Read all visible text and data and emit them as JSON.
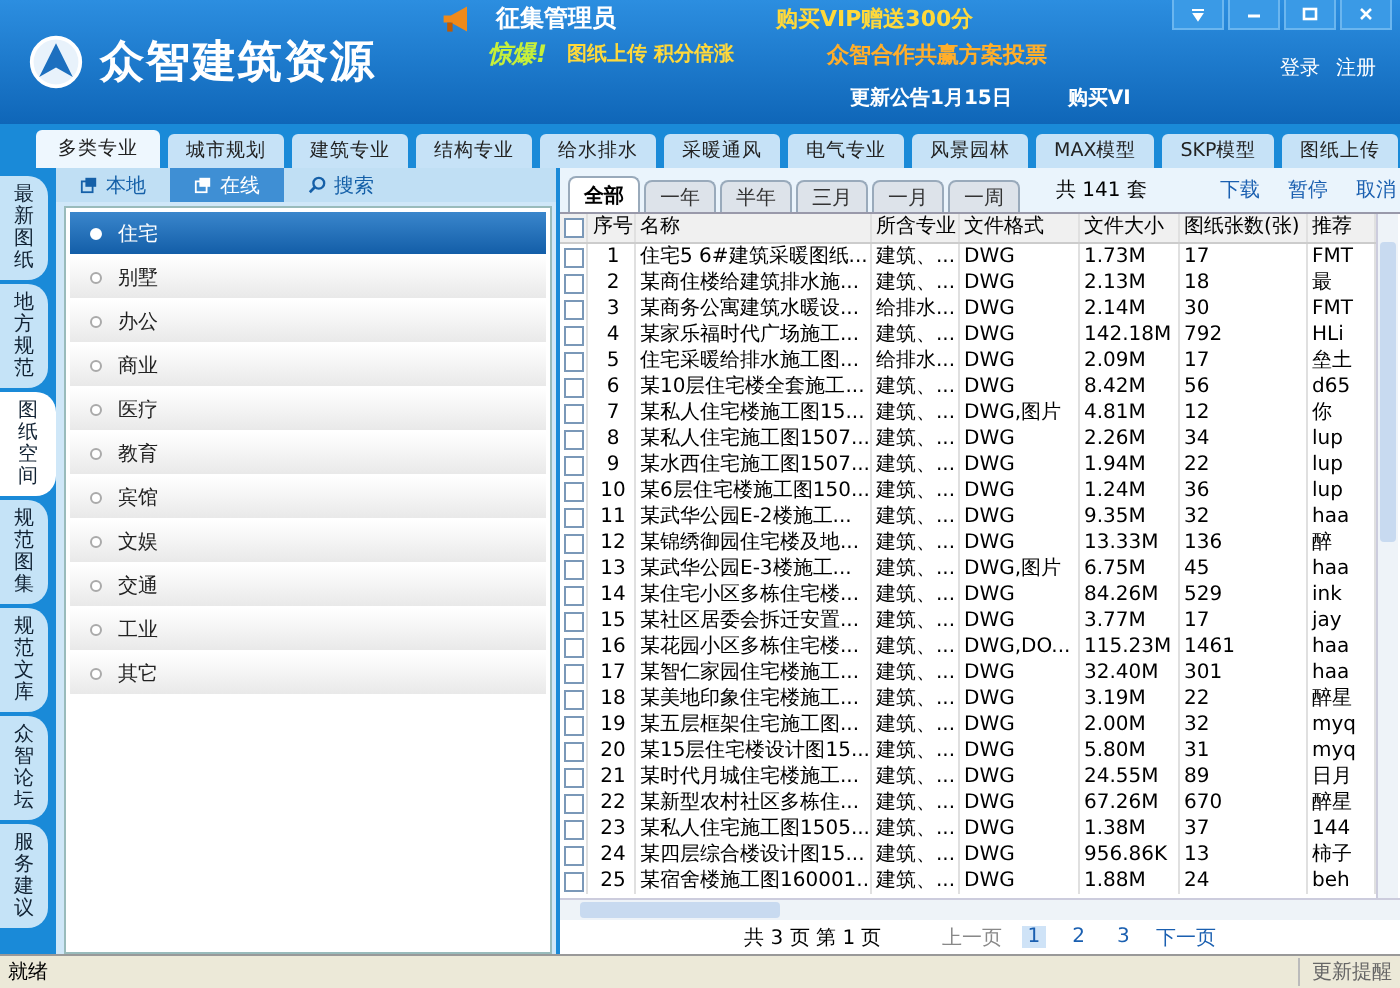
{
  "header": {
    "app_title": "众智建筑资源",
    "banner_title": "征集管理员",
    "banner_vip": "购买VIP赠送300分",
    "banner_alert": "惊爆!",
    "banner_upload": "图纸上传 积分倍涨",
    "banner_vote": "众智合作共赢方案投票",
    "notice": "更新公告1月15日",
    "buy": "购买VI",
    "login": "登录",
    "register": "注册"
  },
  "category_tabs": [
    {
      "label": "多类专业",
      "selected": true
    },
    {
      "label": "城市规划",
      "selected": false
    },
    {
      "label": "建筑专业",
      "selected": false
    },
    {
      "label": "结构专业",
      "selected": false
    },
    {
      "label": "给水排水",
      "selected": false
    },
    {
      "label": "采暖通风",
      "selected": false
    },
    {
      "label": "电气专业",
      "selected": false
    },
    {
      "label": "风景园林",
      "selected": false
    },
    {
      "label": "MAX模型",
      "selected": false
    },
    {
      "label": "SKP模型",
      "selected": false
    },
    {
      "label": "图纸上传",
      "selected": false
    }
  ],
  "side_tabs": [
    {
      "label": "最新图纸",
      "selected": false
    },
    {
      "label": "地方规范",
      "selected": false
    },
    {
      "label": "图纸空间",
      "selected": true
    },
    {
      "label": "规范图集",
      "selected": false
    },
    {
      "label": "规范文库",
      "selected": false
    },
    {
      "label": "众智论坛",
      "selected": false
    },
    {
      "label": "服务建议",
      "selected": false
    }
  ],
  "source_buttons": [
    {
      "label": "本地",
      "kind": "window",
      "selected": false
    },
    {
      "label": "在线",
      "kind": "window",
      "selected": true
    },
    {
      "label": "搜索",
      "kind": "search",
      "selected": false
    }
  ],
  "types": [
    {
      "label": "住宅",
      "selected": true
    },
    {
      "label": "别墅",
      "selected": false
    },
    {
      "label": "办公",
      "selected": false
    },
    {
      "label": "商业",
      "selected": false
    },
    {
      "label": "医疗",
      "selected": false
    },
    {
      "label": "教育",
      "selected": false
    },
    {
      "label": "宾馆",
      "selected": false
    },
    {
      "label": "文娱",
      "selected": false
    },
    {
      "label": "交通",
      "selected": false
    },
    {
      "label": "工业",
      "selected": false
    },
    {
      "label": "其它",
      "selected": false
    }
  ],
  "periods": [
    {
      "label": "全部",
      "selected": true
    },
    {
      "label": "一年",
      "selected": false
    },
    {
      "label": "半年",
      "selected": false
    },
    {
      "label": "三月",
      "selected": false
    },
    {
      "label": "一月",
      "selected": false
    },
    {
      "label": "一周",
      "selected": false
    }
  ],
  "total": "共 141 套",
  "actions": [
    "下载",
    "暂停",
    "取消"
  ],
  "table": {
    "select_all_checked": false,
    "columns": [
      "序号",
      "名称",
      "所含专业",
      "文件格式",
      "文件大小",
      "图纸张数(张)",
      "推荐"
    ],
    "rows": [
      {
        "checked": false,
        "cells": [
          "1",
          "住宅5 6#建筑采暖图纸...",
          "建筑、...",
          "DWG",
          "1.73M",
          "17",
          "FMT"
        ]
      },
      {
        "checked": false,
        "cells": [
          "2",
          "某商住楼给建筑排水施...",
          "建筑、...",
          "DWG",
          "2.13M",
          "18",
          "最"
        ]
      },
      {
        "checked": false,
        "cells": [
          "3",
          "某商务公寓建筑水暖设...",
          "给排水...",
          "DWG",
          "2.14M",
          "30",
          "FMT"
        ]
      },
      {
        "checked": false,
        "cells": [
          "4",
          "某家乐福时代广场施工...",
          "建筑、...",
          "DWG",
          "142.18M",
          "792",
          "HLi"
        ]
      },
      {
        "checked": false,
        "cells": [
          "5",
          "住宅采暖给排水施工图...",
          "给排水...",
          "DWG",
          "2.09M",
          "17",
          "垒土"
        ]
      },
      {
        "checked": false,
        "cells": [
          "6",
          "某10层住宅楼全套施工...",
          "建筑、...",
          "DWG",
          "8.42M",
          "56",
          "d65"
        ]
      },
      {
        "checked": false,
        "cells": [
          "7",
          "某私人住宅楼施工图15...",
          "建筑、...",
          "DWG,图片",
          "4.81M",
          "12",
          "你"
        ]
      },
      {
        "checked": false,
        "cells": [
          "8",
          "某私人住宅施工图1507...",
          "建筑、...",
          "DWG",
          "2.26M",
          "34",
          "lup"
        ]
      },
      {
        "checked": false,
        "cells": [
          "9",
          "某水西住宅施工图1507...",
          "建筑、...",
          "DWG",
          "1.94M",
          "22",
          "lup"
        ]
      },
      {
        "checked": false,
        "cells": [
          "10",
          "某6层住宅楼施工图150...",
          "建筑、...",
          "DWG",
          "1.24M",
          "36",
          "lup"
        ]
      },
      {
        "checked": false,
        "cells": [
          "11",
          "某武华公园E-2楼施工...",
          "建筑、...",
          "DWG",
          "9.35M",
          "32",
          "haa"
        ]
      },
      {
        "checked": false,
        "cells": [
          "12",
          "某锦绣御园住宅楼及地...",
          "建筑、...",
          "DWG",
          "13.33M",
          "136",
          "醉"
        ]
      },
      {
        "checked": false,
        "cells": [
          "13",
          "某武华公园E-3楼施工...",
          "建筑、...",
          "DWG,图片",
          "6.75M",
          "45",
          "haa"
        ]
      },
      {
        "checked": false,
        "cells": [
          "14",
          "某住宅小区多栋住宅楼...",
          "建筑、...",
          "DWG",
          "84.26M",
          "529",
          "ink"
        ]
      },
      {
        "checked": false,
        "cells": [
          "15",
          "某社区居委会拆迁安置...",
          "建筑、...",
          "DWG",
          "3.77M",
          "17",
          "jay"
        ]
      },
      {
        "checked": false,
        "cells": [
          "16",
          "某花园小区多栋住宅楼...",
          "建筑、...",
          "DWG,DO...",
          "115.23M",
          "1461",
          "haa"
        ]
      },
      {
        "checked": false,
        "cells": [
          "17",
          "某智仁家园住宅楼施工...",
          "建筑、...",
          "DWG",
          "32.40M",
          "301",
          "haa"
        ]
      },
      {
        "checked": false,
        "cells": [
          "18",
          "某美地印象住宅楼施工...",
          "建筑、...",
          "DWG",
          "3.19M",
          "22",
          "醉星"
        ]
      },
      {
        "checked": false,
        "cells": [
          "19",
          "某五层框架住宅施工图...",
          "建筑、...",
          "DWG",
          "2.00M",
          "32",
          "myq"
        ]
      },
      {
        "checked": false,
        "cells": [
          "20",
          "某15层住宅楼设计图15...",
          "建筑、...",
          "DWG",
          "5.80M",
          "31",
          "myq"
        ]
      },
      {
        "checked": false,
        "cells": [
          "21",
          "某时代月城住宅楼施工...",
          "建筑、...",
          "DWG",
          "24.55M",
          "89",
          "日月"
        ]
      },
      {
        "checked": false,
        "cells": [
          "22",
          "某新型农村社区多栋住...",
          "建筑、...",
          "DWG",
          "67.26M",
          "670",
          "醉星"
        ]
      },
      {
        "checked": false,
        "cells": [
          "23",
          "某私人住宅施工图1505...",
          "建筑、...",
          "DWG",
          "1.38M",
          "37",
          "144"
        ]
      },
      {
        "checked": false,
        "cells": [
          "24",
          "某四层综合楼设计图15...",
          "建筑、...",
          "DWG",
          "956.86K",
          "13",
          "柿子"
        ]
      },
      {
        "checked": false,
        "cells": [
          "25",
          "某宿舍楼施工图160001...",
          "建筑、...",
          "DWG",
          "1.88M",
          "24",
          "beh"
        ]
      }
    ]
  },
  "pagination": {
    "summary": "共 3 页 第 1 页",
    "prev": "上一页",
    "pages": [
      {
        "label": "1",
        "selected": true
      },
      {
        "label": "2",
        "selected": false
      },
      {
        "label": "3",
        "selected": false
      }
    ],
    "next": "下一页"
  },
  "status_bar": {
    "text": "就绪",
    "update": "更新提醒"
  }
}
